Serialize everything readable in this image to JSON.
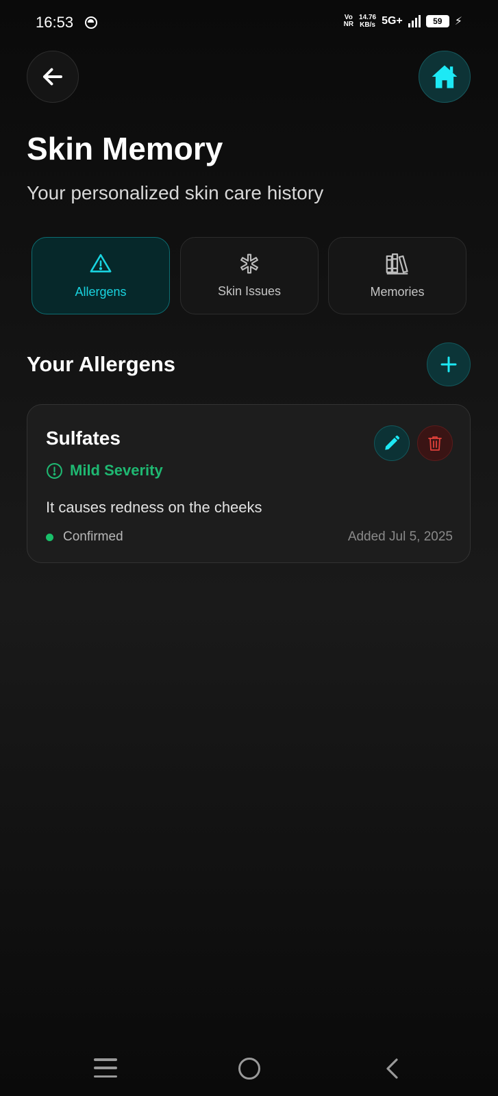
{
  "status_bar": {
    "time": "16:53",
    "volte_top": "Vo",
    "volte_bottom": "NR",
    "speed_value": "14.76",
    "speed_unit": "KB/s",
    "network": "5G+",
    "battery": "59"
  },
  "header": {
    "title": "Skin Memory",
    "subtitle": "Your personalized skin care history"
  },
  "tabs": [
    {
      "label": "Allergens",
      "icon": "warning-triangle-icon",
      "active": true
    },
    {
      "label": "Skin Issues",
      "icon": "asterisk-icon",
      "active": false
    },
    {
      "label": "Memories",
      "icon": "books-icon",
      "active": false
    }
  ],
  "section": {
    "title": "Your Allergens"
  },
  "allergens": [
    {
      "name": "Sulfates",
      "severity": "Mild Severity",
      "description": "It causes redness on the cheeks",
      "status": "Confirmed",
      "added": "Added Jul 5, 2025"
    }
  ],
  "colors": {
    "accent": "#19d4e0",
    "severity_mild": "#1fb872",
    "delete": "#e0403a",
    "status_confirmed": "#19c06a"
  }
}
